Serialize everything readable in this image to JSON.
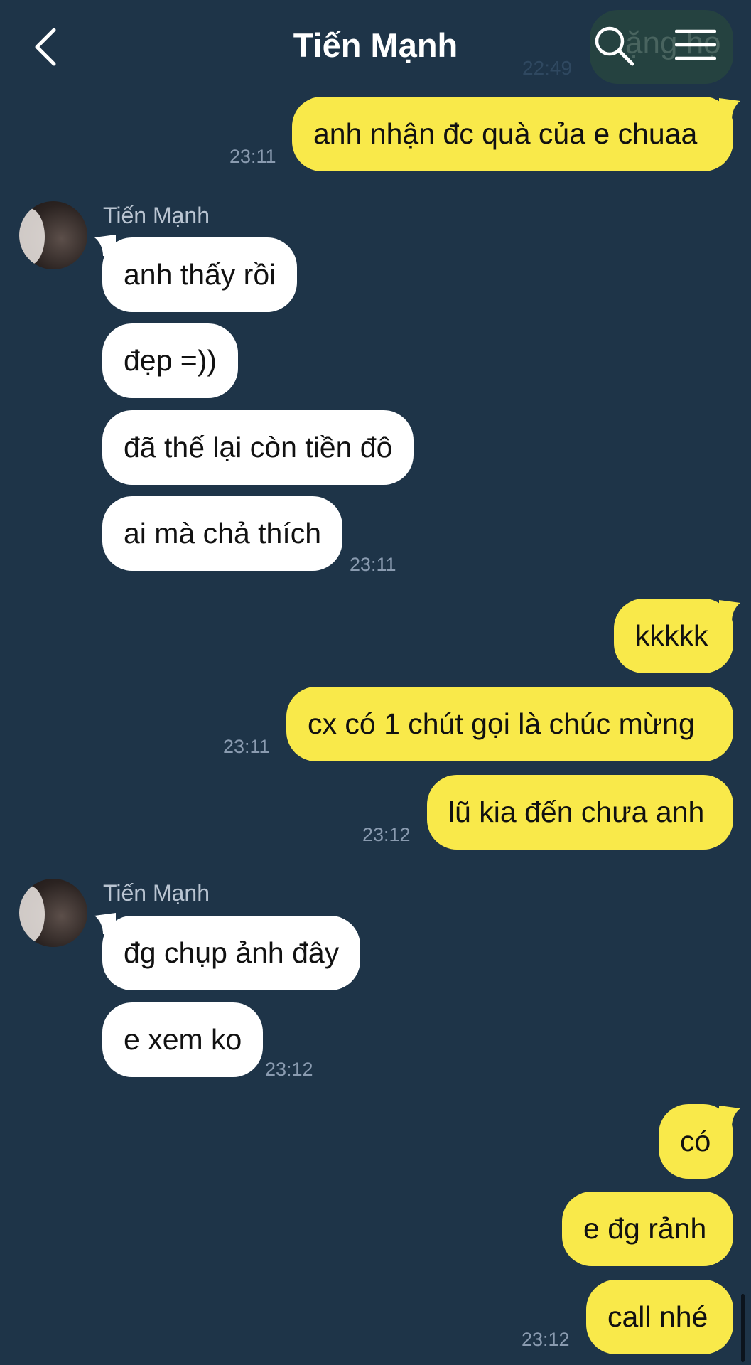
{
  "header": {
    "title": "Tiến Mạnh",
    "peek_text": "ặng họ",
    "peek_time": "22:49"
  },
  "messages": {
    "m1": {
      "text": "anh nhận đc quà của e chuaa",
      "time": "23:11"
    },
    "g1": {
      "sender": "Tiến Mạnh",
      "b1": "anh thấy rồi",
      "b2": "đẹp =))",
      "b3": "đã thế lại còn tiền đô",
      "b4": "ai mà chả thích",
      "time": "23:11"
    },
    "m2": {
      "b1": "kkkkk",
      "b2": "cx có 1 chút gọi là chúc mừng",
      "time": "23:11"
    },
    "m3": {
      "text": "lũ kia đến chưa anh",
      "time": "23:12"
    },
    "g2": {
      "sender": "Tiến Mạnh",
      "b1": "đg chụp ảnh đây",
      "b2": "e xem ko",
      "time": "23:12"
    },
    "m4": {
      "b1": "có",
      "b2": "e đg rảnh",
      "b3": "call nhé",
      "time": "23:12"
    }
  },
  "colors": {
    "background": "#1e3448",
    "my_bubble": "#f9e94a",
    "their_bubble": "#ffffff",
    "timestamp": "#8a9bb0"
  },
  "icons": [
    "back-icon",
    "search-icon",
    "menu-icon"
  ]
}
